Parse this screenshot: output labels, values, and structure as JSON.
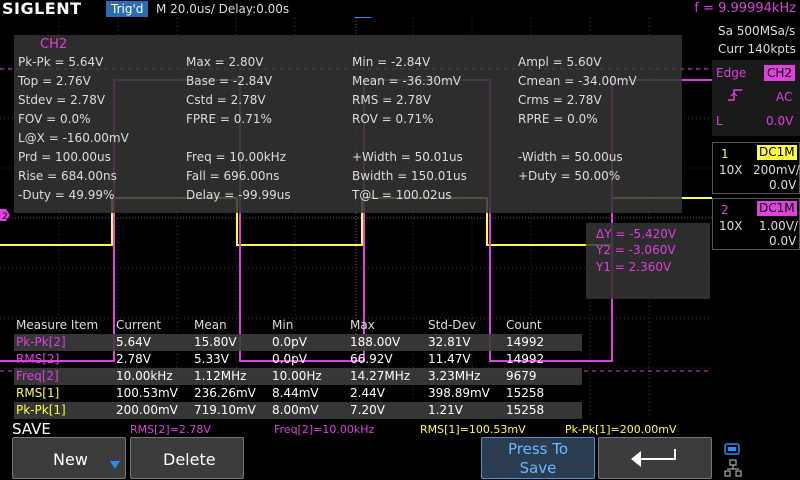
{
  "header": {
    "brand": "SIGLENT",
    "trigger_status": "Trig'd",
    "timebase": "M 20.0us/  Delay:0.00s",
    "frequency": "f = 9.99994kHz"
  },
  "acquisition": {
    "sample_rate": "Sa 500MSa/s",
    "memory": "Curr 140kpts"
  },
  "trigger": {
    "type": "Edge",
    "source": "CH2",
    "coupling": "AC",
    "mode": "L",
    "level": "0.0V"
  },
  "channels": [
    {
      "num": "1",
      "coupling": "DC1M",
      "probe": "10X",
      "scale": "200mV/",
      "offset": "0.0V",
      "color": "#ffff40"
    },
    {
      "num": "2",
      "coupling": "DC1M",
      "probe": "10X",
      "scale": "1.00V/",
      "offset": "0.0V",
      "color": "#e040e0"
    }
  ],
  "stats": {
    "title": "CH2",
    "rows": [
      [
        "Pk-Pk = 5.64V",
        "Max = 2.80V",
        "Min = -2.84V",
        "Ampl = 5.60V"
      ],
      [
        "Top = 2.76V",
        "Base = -2.84V",
        "Mean = -36.30mV",
        "Cmean = -34.00mV"
      ],
      [
        "Stdev = 2.78V",
        "Cstd = 2.78V",
        "RMS = 2.78V",
        "Crms = 2.78V"
      ],
      [
        "FOV = 0.0%",
        "FPRE = 0.71%",
        "ROV = 0.71%",
        "RPRE = 0.0%"
      ],
      [
        "L@X = -160.00mV",
        "",
        "",
        ""
      ],
      [
        "Prd = 100.00us",
        "Freq = 10.00kHz",
        "+Width = 50.01us",
        "-Width = 50.00us"
      ],
      [
        "Rise = 684.00ns",
        "Fall = 696.00ns",
        "Bwidth = 150.01us",
        "+Duty = 50.00%"
      ],
      [
        "-Duty = 49.99%",
        "Delay = -99.99us",
        "T@L = 100.02us",
        ""
      ]
    ]
  },
  "cursors": {
    "dy": "ΔY = -5.420V",
    "y2": "Y2 = -3.060V",
    "y1": "Y1 = 2.360V"
  },
  "measure_table": {
    "headers": [
      "Measure Item",
      "Current",
      "Mean",
      "Min",
      "Max",
      "Std-Dev",
      "Count"
    ],
    "rows": [
      {
        "cells": [
          "Pk-Pk[2]",
          "5.64V",
          "15.80V",
          "0.0pV",
          "188.00V",
          "32.81V",
          "14992"
        ],
        "color": "#e040e0"
      },
      {
        "cells": [
          "RMS[2]",
          "2.78V",
          "5.33V",
          "0.0pV",
          "66.92V",
          "11.47V",
          "14992"
        ],
        "color": "#e040e0"
      },
      {
        "cells": [
          "Freq[2]",
          "10.00kHz",
          "1.12MHz",
          "10.00Hz",
          "14.27MHz",
          "3.23MHz",
          "9679"
        ],
        "color": "#e040e0"
      },
      {
        "cells": [
          "RMS[1]",
          "100.53mV",
          "236.26mV",
          "8.44mV",
          "2.44V",
          "398.89mV",
          "15258"
        ],
        "color": "#ffff40"
      },
      {
        "cells": [
          "Pk-Pk[1]",
          "200.00mV",
          "719.10mV",
          "8.00mV",
          "7.20V",
          "1.21V",
          "15258"
        ],
        "color": "#ffff40"
      }
    ]
  },
  "status_row": [
    {
      "text": "RMS[2]=2.78V",
      "color": "#e040e0"
    },
    {
      "text": "Freq[2]=10.00kHz",
      "color": "#e040e0"
    },
    {
      "text": "RMS[1]=100.53mV",
      "color": "#ffff40"
    },
    {
      "text": "Pk-Pk[1]=200.00mV",
      "color": "#ffff40"
    }
  ],
  "menu": {
    "title": "SAVE",
    "softkeys": {
      "new": "New",
      "delete": "Delete",
      "press_to_save": "Press To Save"
    }
  },
  "icons": {
    "return": "return-arrow-icon",
    "network": "network-icon",
    "usb": "usb-icon",
    "ch2_ground_marker": "ground-marker-icon"
  }
}
